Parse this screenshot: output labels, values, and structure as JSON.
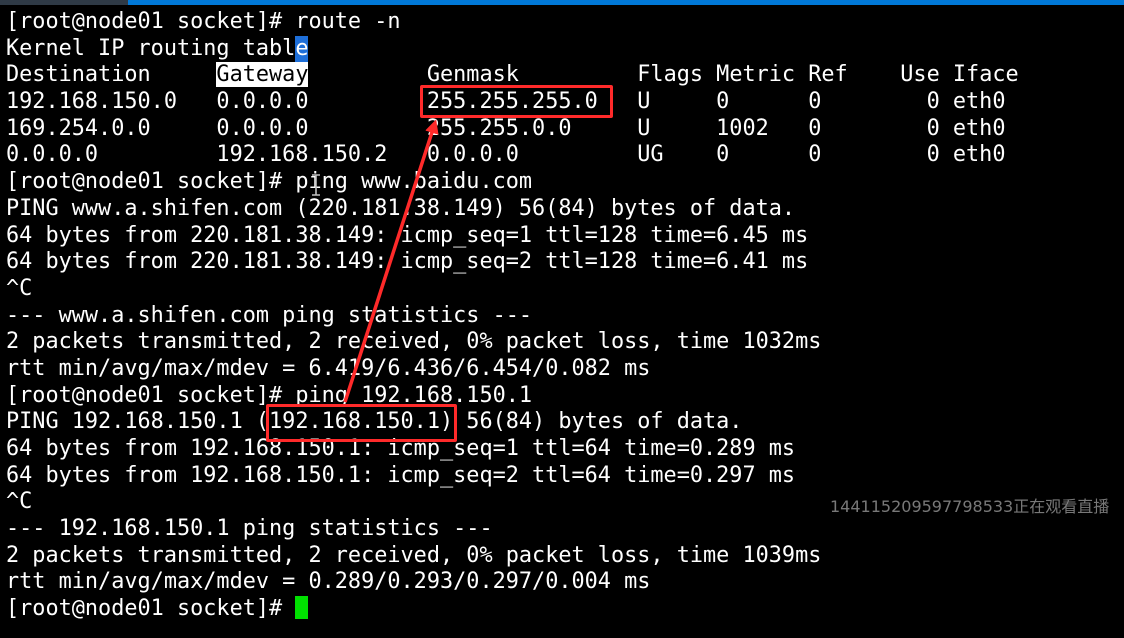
{
  "terminal": {
    "lines": [
      "[root@node01 socket]# route -n",
      "Kernel IP routing table",
      "Destination     Gateway         Genmask         Flags Metric Ref    Use Iface",
      "192.168.150.0   0.0.0.0         255.255.255.0   U     0      0        0 eth0",
      "169.254.0.0     0.0.0.0         255.255.0.0     U     1002   0        0 eth0",
      "0.0.0.0         192.168.150.2   0.0.0.0         UG    0      0        0 eth0",
      "[root@node01 socket]# ping www.baidu.com",
      "PING www.a.shifen.com (220.181.38.149) 56(84) bytes of data.",
      "64 bytes from 220.181.38.149: icmp_seq=1 ttl=128 time=6.45 ms",
      "64 bytes from 220.181.38.149: icmp_seq=2 ttl=128 time=6.41 ms",
      "^C",
      "--- www.a.shifen.com ping statistics ---",
      "2 packets transmitted, 2 received, 0% packet loss, time 1032ms",
      "rtt min/avg/max/mdev = 6.419/6.436/6.454/0.082 ms",
      "[root@node01 socket]# ping 192.168.150.1",
      "PING 192.168.150.1 (192.168.150.1) 56(84) bytes of data.",
      "64 bytes from 192.168.150.1: icmp_seq=1 ttl=64 time=0.289 ms",
      "64 bytes from 192.168.150.1: icmp_seq=2 ttl=64 time=0.297 ms",
      "^C",
      "--- 192.168.150.1 ping statistics ---",
      "2 packets transmitted, 2 received, 0% packet loss, time 1039ms",
      "rtt min/avg/max/mdev = 0.289/0.293/0.297/0.004 ms"
    ],
    "prompt": "[root@node01 socket]# ",
    "highlighted_word": "Gateway",
    "selected_char": "e",
    "cursor_color": "#00e000"
  },
  "annotations": {
    "box_color": "#ff2a2a",
    "arrow_color": "#ff2a2a"
  },
  "watermark": {
    "text": "144115209597798533正在观看直播"
  }
}
